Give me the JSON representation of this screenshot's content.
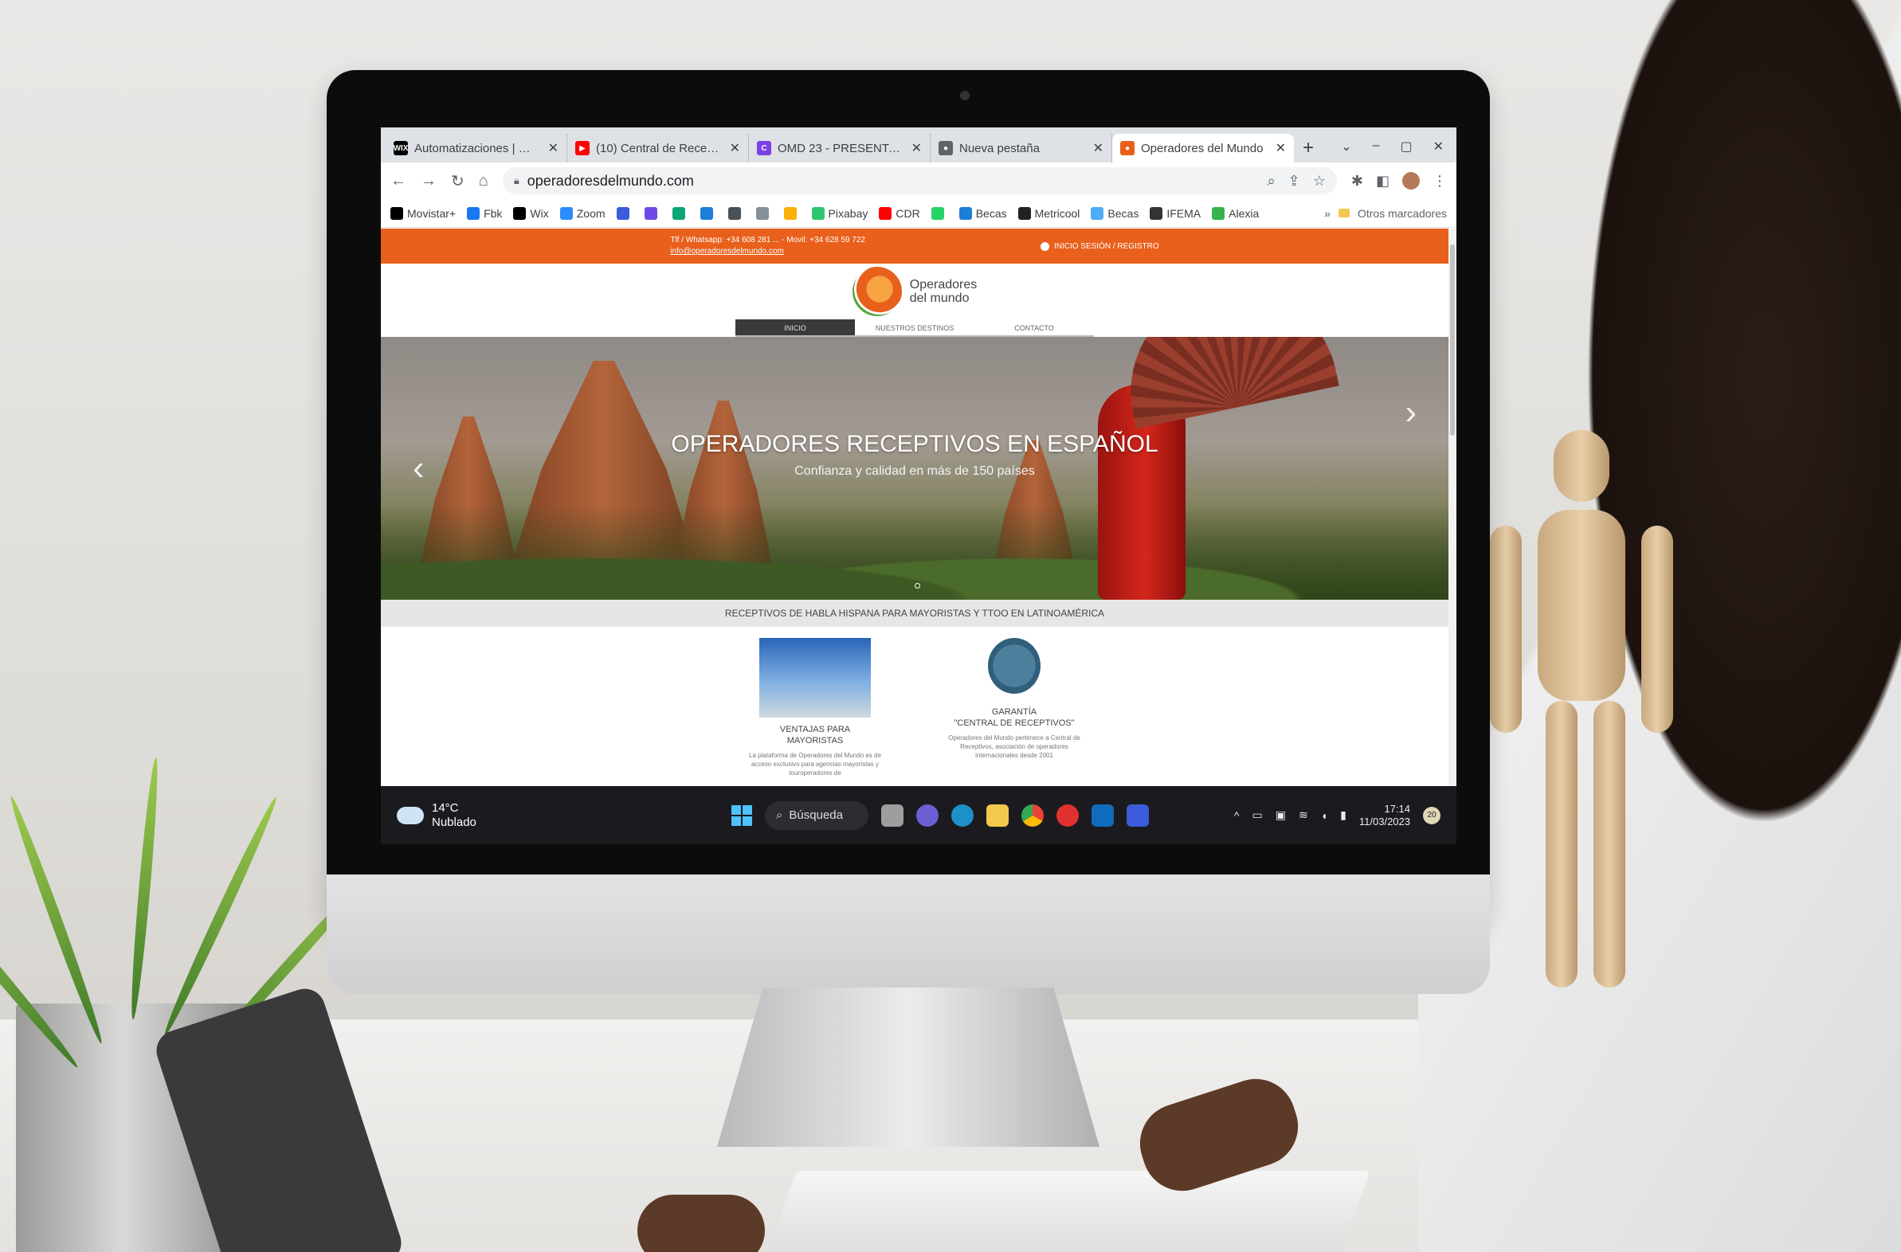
{
  "browser": {
    "tabs": [
      {
        "title": "Automatizaciones | Wix.com",
        "favicon_label": "WIX",
        "favicon_color": "#000000",
        "active": false
      },
      {
        "title": "(10) Central de Receptivos",
        "favicon_label": "▶",
        "favicon_color": "#ff0000",
        "active": false
      },
      {
        "title": "OMD 23 - PRESENTACIÓN",
        "favicon_label": "C",
        "favicon_color": "#7b3fe4",
        "active": false
      },
      {
        "title": "Nueva pestaña",
        "favicon_label": "●",
        "favicon_color": "#5f6368",
        "active": false
      },
      {
        "title": "Operadores del Mundo",
        "favicon_label": "●",
        "favicon_color": "#e8601c",
        "active": true
      }
    ],
    "new_tab_label": "+",
    "window_controls": {
      "dropdown": "⌄",
      "minimize": "–",
      "restore": "▢",
      "close": "✕"
    },
    "url": "operadoresdelmundo.com",
    "bookmarks": [
      {
        "label": "Movistar+",
        "icon": "plus-icon",
        "color": "#000000"
      },
      {
        "label": "Fbk",
        "icon": "facebook-icon",
        "color": "#1877f2"
      },
      {
        "label": "Wix",
        "icon": "wix-icon",
        "color": "#000000"
      },
      {
        "label": "Zoom",
        "icon": "zoom-icon",
        "color": "#2d8cff"
      },
      {
        "label": "",
        "icon": "bookmark-icon",
        "color": "#3b5bdb"
      },
      {
        "label": "",
        "icon": "bookmark-icon",
        "color": "#7048e8"
      },
      {
        "label": "",
        "icon": "bookmark-icon",
        "color": "#0ca678"
      },
      {
        "label": "",
        "icon": "bookmark-icon",
        "color": "#1c7ed6"
      },
      {
        "label": "",
        "icon": "bookmark-icon",
        "color": "#495057"
      },
      {
        "label": "",
        "icon": "bookmark-icon",
        "color": "#868e96"
      },
      {
        "label": "",
        "icon": "bookmark-icon",
        "color": "#fab005"
      },
      {
        "label": "Pixabay",
        "icon": "pixabay-icon",
        "color": "#2ec66d"
      },
      {
        "label": "CDR",
        "icon": "youtube-icon",
        "color": "#ff0000"
      },
      {
        "label": "",
        "icon": "whatsapp-icon",
        "color": "#25d366"
      },
      {
        "label": "Becas",
        "icon": "becas-icon",
        "color": "#1c7ed6"
      },
      {
        "label": "Metricool",
        "icon": "metricool-icon",
        "color": "#222222"
      },
      {
        "label": "Becas",
        "icon": "becas-icon",
        "color": "#4dabf7"
      },
      {
        "label": "IFEMA",
        "icon": "globe-icon",
        "color": "#333333"
      },
      {
        "label": "Alexia",
        "icon": "alexia-icon",
        "color": "#37b24d"
      }
    ],
    "bookmarks_overflow": "»",
    "other_bookmarks": "Otros marcadores"
  },
  "site": {
    "topbar_phone": "Tlf / Whatsapp: +34 608 281 ... - Movil: +34 628 59 722",
    "topbar_email": "info@operadoresdelmundo.com",
    "topbar_login": "INICIO SESIÓN / REGISTRO",
    "brand_line1": "Operadores",
    "brand_line2": "del mundo",
    "nav": [
      {
        "label": "INICIO",
        "active": true
      },
      {
        "label": "NUESTROS DESTINOS",
        "active": false
      },
      {
        "label": "CONTACTO",
        "active": false
      }
    ],
    "hero_title": "OPERADORES RECEPTIVOS EN ESPAÑOL",
    "hero_subtitle": "Confianza y calidad en más de 150 países",
    "hero_prev": "‹",
    "hero_next": "›",
    "tagline": "RECEPTIVOS DE HABLA HISPANA PARA MAYORISTAS Y TTOO EN LATINOAMÉRICA",
    "features": [
      {
        "title_line1": "VENTAJAS PARA",
        "title_line2": "MAYORISTAS",
        "text": "La plataforma de Operadores del Mundo es de acceso exclusivo para agencias mayoristas y touroperadores de"
      },
      {
        "title_line1": "GARANTÍA",
        "title_line2": "\"CENTRAL DE RECEPTIVOS\"",
        "text": "Operadores del Mundo pertenece a Central de Receptivos, asociación de operadores internacionales desde 2001"
      }
    ]
  },
  "taskbar": {
    "weather_temp": "14°C",
    "weather_desc": "Nublado",
    "search_label": "Búsqueda",
    "time": "17:14",
    "date": "11/03/2023",
    "notification_count": "20"
  },
  "colors": {
    "brand_orange": "#e8601c",
    "chrome_tab_strip": "#dee1e6",
    "taskbar": "#1b1b1f"
  }
}
